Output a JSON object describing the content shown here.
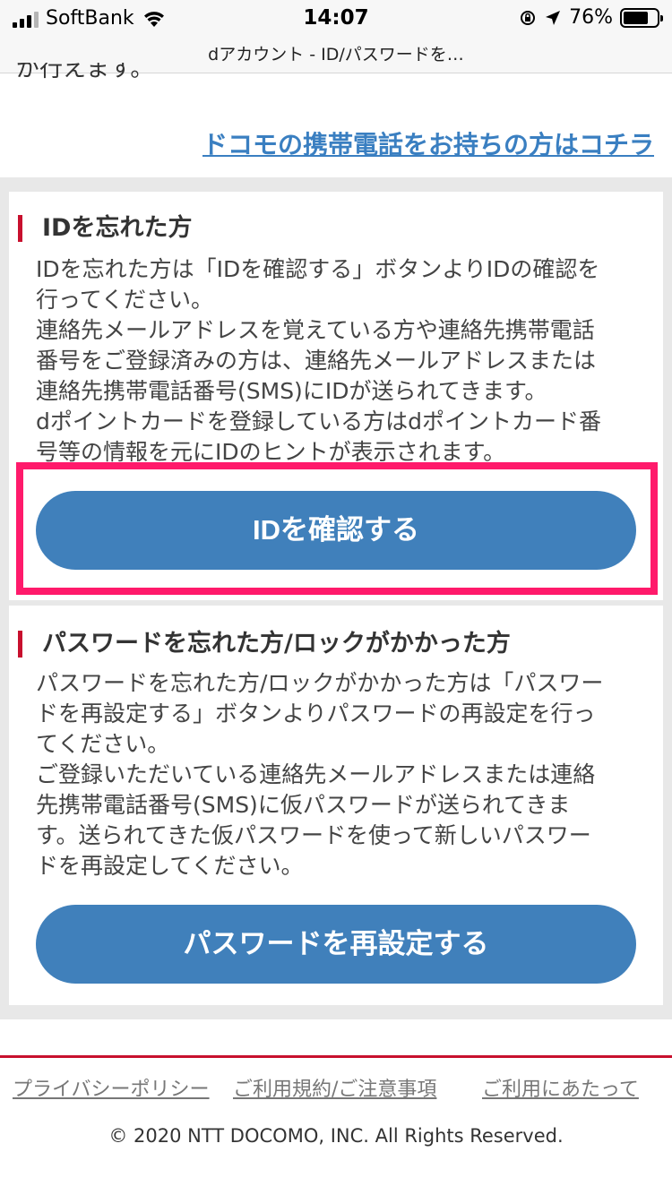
{
  "status_bar": {
    "carrier": "SoftBank",
    "time": "14:07",
    "battery": "76%",
    "battery_level": 0.76
  },
  "browser": {
    "title": "dアカウント - ID/パスワードを…"
  },
  "top": {
    "cut_text": "が行えます。",
    "docomo_link": "ドコモの携帯電話をお持ちの方はコチラ"
  },
  "id_section": {
    "heading": "IDを忘れた方",
    "lines": [
      "IDを忘れた方は「IDを確認する」ボタンよりIDの確認を",
      "行ってください。",
      "連絡先メールアドレスを覚えている方や連絡先携帯電話",
      "番号をご登録済みの方は、連絡先メールアドレスまたは",
      "連絡先携帯電話番号(SMS)にIDが送られてきます。",
      "dポイントカードを登録している方はdポイントカード番",
      "号等の情報を元にIDのヒントが表示されます。"
    ],
    "button": "IDを確認する"
  },
  "pw_section": {
    "heading": "パスワードを忘れた方/ロックがかかった方",
    "lines": [
      "パスワードを忘れた方/ロックがかかった方は「パスワー",
      "ドを再設定する」ボタンよりパスワードの再設定を行っ",
      "てください。",
      "ご登録いただいている連絡先メールアドレスまたは連絡",
      "先携帯電話番号(SMS)に仮パスワードが送られてきま",
      "す。送られてきた仮パスワードを使って新しいパスワー",
      "ドを再設定してください。"
    ],
    "button": "パスワードを再設定する"
  },
  "footer": {
    "privacy": "プライバシーポリシー",
    "terms": "ご利用規約/ご注意事項",
    "usage": "ご利用にあたって",
    "copyright": "© 2020 NTT DOCOMO, INC. All Rights Reserved."
  },
  "colors": {
    "accent_blue": "#4080bb",
    "link_blue": "#3a7fc1",
    "heading_bar_red": "#c8102e",
    "highlight_pink": "#ff1a6b"
  }
}
